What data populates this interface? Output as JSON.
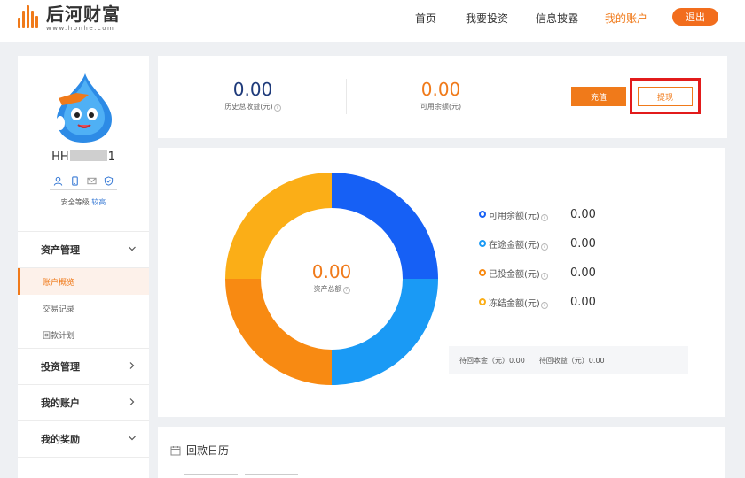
{
  "header": {
    "logo_cn": "后河财富",
    "logo_url": "www.honhe.com",
    "nav": [
      {
        "label": "首页",
        "active": false
      },
      {
        "label": "我要投资",
        "active": false
      },
      {
        "label": "信息披露",
        "active": false
      },
      {
        "label": "我的账户",
        "active": true
      }
    ],
    "logout_label": "退出"
  },
  "sidebar": {
    "username_prefix": "HH",
    "username_suffix": "1",
    "security_label": "安全等级",
    "security_level": "较高",
    "menu": {
      "asset_mgmt": "资产管理",
      "account_overview": "账户概览",
      "transactions": "交易记录",
      "repayment_plan": "回款计划",
      "investment_mgmt": "投资管理",
      "my_account": "我的账户",
      "my_rewards": "我的奖励"
    }
  },
  "summary": {
    "total_income_value": "0.00",
    "total_income_label": "历史总收益(元)",
    "available_value": "0.00",
    "available_label": "可用余额(元)",
    "recharge_label": "充值",
    "withdraw_label": "提现"
  },
  "assets": {
    "total_value": "0.00",
    "total_label": "资产总额",
    "legend": [
      {
        "label": "可用余额(元)",
        "value": "0.00",
        "color": "#1660f5"
      },
      {
        "label": "在途金额(元)",
        "value": "0.00",
        "color": "#1a9af5"
      },
      {
        "label": "已投金额(元)",
        "value": "0.00",
        "color": "#f88a12"
      },
      {
        "label": "冻结金额(元)",
        "value": "0.00",
        "color": "#fbae17"
      }
    ],
    "pending_principal": "待回本金（元）0.00",
    "pending_income": "待回收益（元）0.00"
  },
  "calendar": {
    "title": "回款日历"
  },
  "colors": {
    "accent": "#f07a1a",
    "highlight_box": "#e21b1b"
  }
}
